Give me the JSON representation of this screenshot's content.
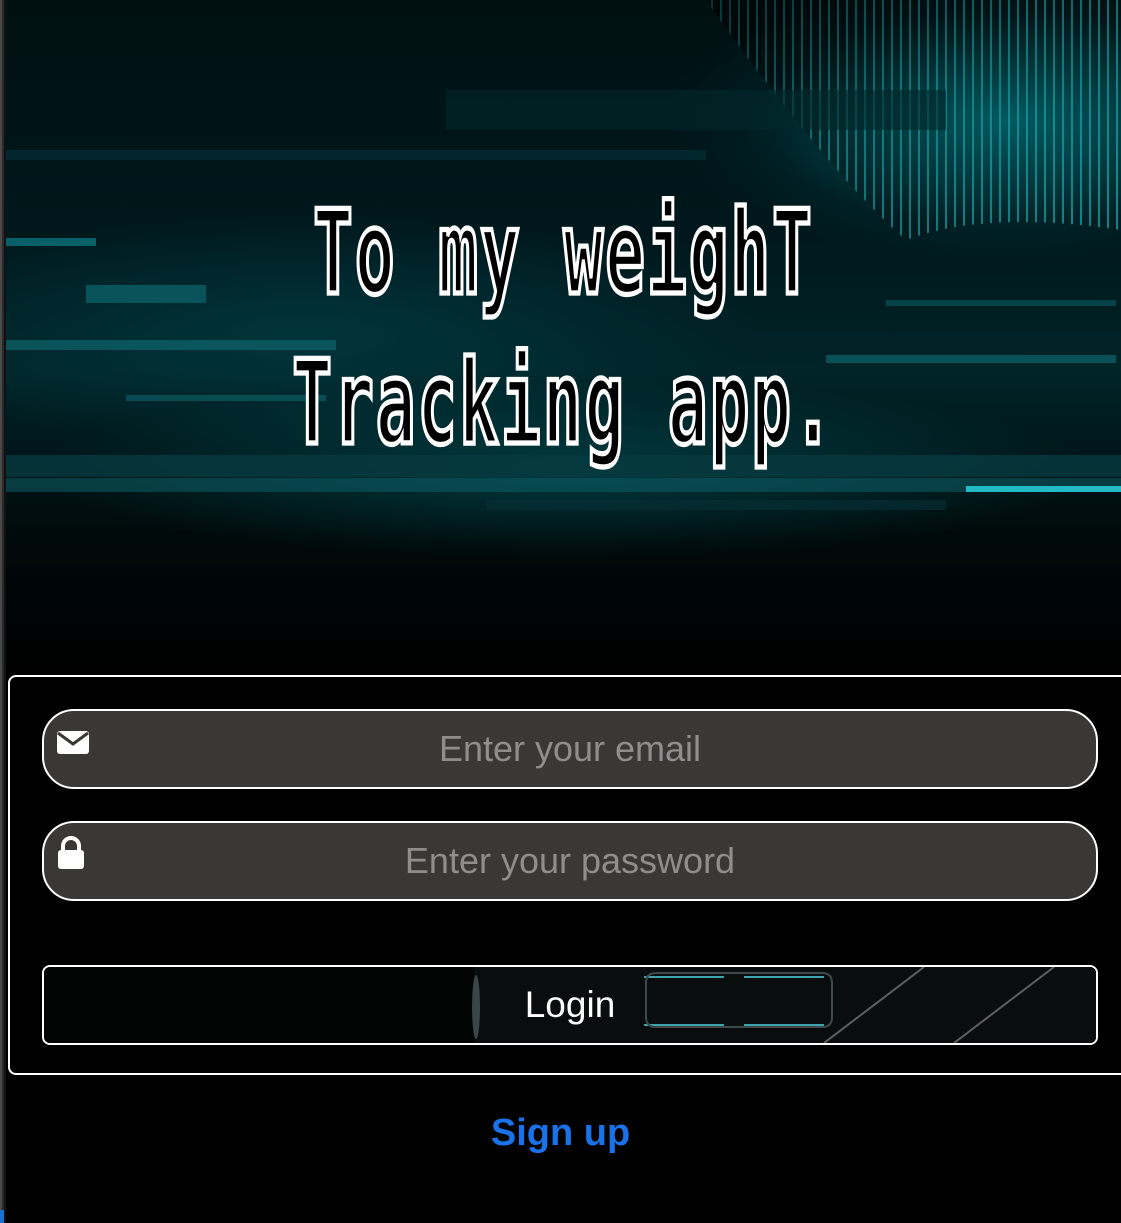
{
  "hero": {
    "title_line_1": "To my weighT",
    "title_line_2": "Tracking app."
  },
  "form": {
    "email": {
      "icon": "envelope-icon",
      "placeholder": "Enter your email",
      "value": ""
    },
    "password": {
      "icon": "lock-icon",
      "placeholder": "Enter your password",
      "value": ""
    },
    "login_label": "Login"
  },
  "signup_label": "Sign up",
  "colors": {
    "background": "#000000",
    "accent_teal": "#00b4be",
    "input_fill": "#393837",
    "placeholder": "#8e8e8e",
    "link_blue": "#1a72e8",
    "border": "#ffffff"
  }
}
